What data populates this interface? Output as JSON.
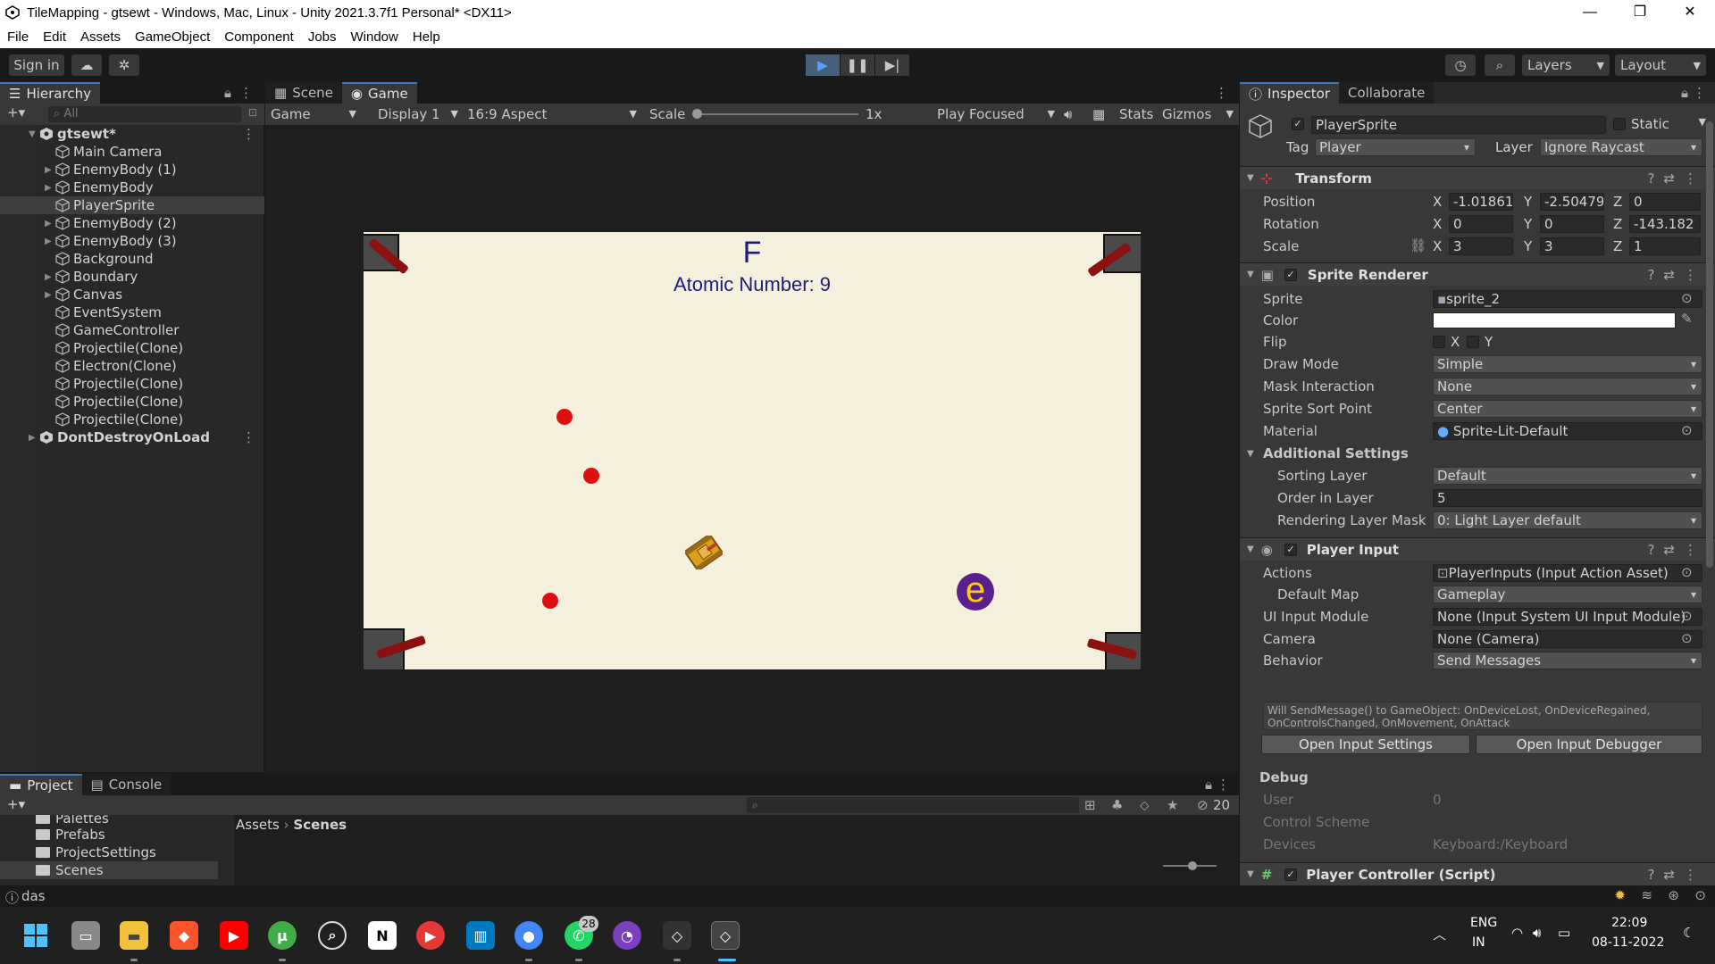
{
  "window": {
    "title": "TileMapping - gtsewt - Windows, Mac, Linux - Unity 2021.3.7f1 Personal* <DX11>",
    "minimize": "—",
    "maximize": "❐",
    "close": "✕"
  },
  "menu": [
    "File",
    "Edit",
    "Assets",
    "GameObject",
    "Component",
    "Jobs",
    "Window",
    "Help"
  ],
  "toolbar": {
    "sign_in": "Sign in",
    "layers": "Layers",
    "layout": "Layout"
  },
  "hierarchy": {
    "tab": "Hierarchy",
    "search_placeholder": "All",
    "items": [
      {
        "label": "gtsewt*",
        "level": "scene",
        "expanded": true
      },
      {
        "label": "Main Camera",
        "level": "child",
        "arrow": false
      },
      {
        "label": "EnemyBody (1)",
        "level": "child",
        "arrow": true
      },
      {
        "label": "EnemyBody",
        "level": "child",
        "arrow": true
      },
      {
        "label": "PlayerSprite",
        "level": "child",
        "arrow": false,
        "selected": true
      },
      {
        "label": "EnemyBody (2)",
        "level": "child",
        "arrow": true
      },
      {
        "label": "EnemyBody (3)",
        "level": "child",
        "arrow": true
      },
      {
        "label": "Background",
        "level": "child",
        "arrow": false
      },
      {
        "label": "Boundary",
        "level": "child",
        "arrow": true
      },
      {
        "label": "Canvas",
        "level": "child",
        "arrow": true
      },
      {
        "label": "EventSystem",
        "level": "child",
        "arrow": false
      },
      {
        "label": "GameController",
        "level": "child",
        "arrow": false
      },
      {
        "label": "Projectile(Clone)",
        "level": "child",
        "arrow": false
      },
      {
        "label": "Electron(Clone)",
        "level": "child",
        "arrow": false
      },
      {
        "label": "Projectile(Clone)",
        "level": "child",
        "arrow": false
      },
      {
        "label": "Projectile(Clone)",
        "level": "child",
        "arrow": false
      },
      {
        "label": "Projectile(Clone)",
        "level": "child",
        "arrow": false
      },
      {
        "label": "DontDestroyOnLoad",
        "level": "scene",
        "expanded": false
      }
    ]
  },
  "game": {
    "tabs": {
      "scene": "Scene",
      "game": "Game"
    },
    "mode": "Game",
    "display": "Display 1",
    "aspect": "16:9 Aspect",
    "scale_label": "Scale",
    "scale_value": "1x",
    "play_focused": "Play Focused",
    "stats": "Stats",
    "gizmos": "Gizmos",
    "element_symbol": "F",
    "atomic_number": "Atomic Number: 9",
    "electron_label": "e"
  },
  "inspector": {
    "tabs": {
      "inspector": "Inspector",
      "collaborate": "Collaborate"
    },
    "object_name": "PlayerSprite",
    "static_label": "Static",
    "tag_label": "Tag",
    "tag_value": "Player",
    "layer_label": "Layer",
    "layer_value": "Ignore Raycast",
    "transform": {
      "title": "Transform",
      "position_label": "Position",
      "rotation_label": "Rotation",
      "scale_label": "Scale",
      "position": {
        "x": "-1.01861",
        "y": "-2.50479",
        "z": "0"
      },
      "rotation": {
        "x": "0",
        "y": "0",
        "z": "-143.182"
      },
      "scale": {
        "x": "3",
        "y": "3",
        "z": "1"
      }
    },
    "sprite_renderer": {
      "title": "Sprite Renderer",
      "sprite_label": "Sprite",
      "sprite_value": "sprite_2",
      "color_label": "Color",
      "color_value": "#ffffff",
      "flip_label": "Flip",
      "flip_x": "X",
      "flip_y": "Y",
      "draw_mode_label": "Draw Mode",
      "draw_mode_value": "Simple",
      "mask_label": "Mask Interaction",
      "mask_value": "None",
      "sort_point_label": "Sprite Sort Point",
      "sort_point_value": "Center",
      "material_label": "Material",
      "material_value": "Sprite-Lit-Default",
      "additional_label": "Additional Settings",
      "sorting_layer_label": "Sorting Layer",
      "sorting_layer_value": "Default",
      "order_label": "Order in Layer",
      "order_value": "5",
      "rendering_mask_label": "Rendering Layer Mask",
      "rendering_mask_value": "0: Light Layer default"
    },
    "player_input": {
      "title": "Player Input",
      "actions_label": "Actions",
      "actions_value": "PlayerInputs (Input Action Asset)",
      "default_map_label": "Default Map",
      "default_map_value": "Gameplay",
      "ui_module_label": "UI Input Module",
      "ui_module_value": "None (Input System UI Input Module)",
      "camera_label": "Camera",
      "camera_value": "None (Camera)",
      "behavior_label": "Behavior",
      "behavior_value": "Send Messages",
      "info": "Will SendMessage() to GameObject: OnDeviceLost, OnDeviceRegained, OnControlsChanged, OnMovement, OnAttack",
      "open_settings": "Open Input Settings",
      "open_debugger": "Open Input Debugger",
      "debug_label": "Debug",
      "user_label": "User",
      "user_value": "0",
      "control_scheme_label": "Control Scheme",
      "devices_label": "Devices",
      "devices_value": "Keyboard:/Keyboard"
    },
    "player_controller": {
      "title": "Player Controller (Script)"
    }
  },
  "project": {
    "tabs": {
      "project": "Project",
      "console": "Console"
    },
    "folders": [
      "Palettes",
      "Prefabs",
      "ProjectSettings",
      "Scenes"
    ],
    "breadcrumb_root": "Assets",
    "breadcrumb_current": "Scenes",
    "hidden_count": "20"
  },
  "status": {
    "message": "das"
  },
  "taskbar": {
    "language": "ENG",
    "region": "IN",
    "time": "22:09",
    "date": "08-11-2022",
    "whatsapp_badge": "28"
  }
}
